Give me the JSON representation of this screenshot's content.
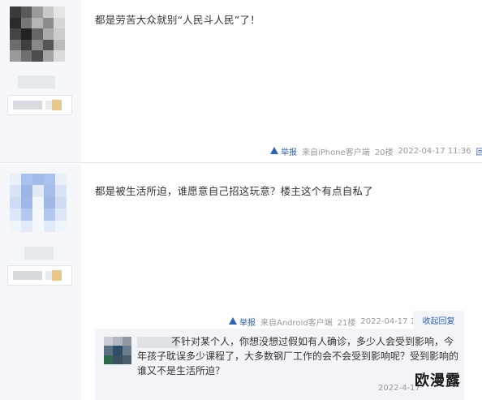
{
  "posts": [
    {
      "content": "都是劳苦大众就别“人民斗人民”了！",
      "meta": {
        "report": "举报",
        "source": "来自iPhone客户端",
        "floor": "20楼",
        "time": "2022-04-17 11:36",
        "reply": "回复"
      }
    },
    {
      "content": "都是被生活所迫，谁愿意自己招这玩意？楼主这个有点自私了",
      "meta": {
        "report": "举报",
        "source": "来自Android客户端",
        "floor": "21楼",
        "time": "2022-04-17 11:49",
        "collapse": "收起回复"
      },
      "sub_reply": {
        "text": "不针对某个人，你想没想过假如有人确诊，多少人会受到影响，今年孩子耽误多少课程了，大多数钢厂工作的会不会受到影响呢？受到影响的谁又不是生活所迫？",
        "time": "2022-4-17"
      }
    }
  ],
  "watermark": "欧漫露",
  "colors": {
    "link": "#2d64b3",
    "meta_text": "#999999",
    "sidebar_bg": "#f5f7fa",
    "reply_bg": "#f2f4f7"
  },
  "icons": {
    "report": "warning-triangle-icon"
  }
}
